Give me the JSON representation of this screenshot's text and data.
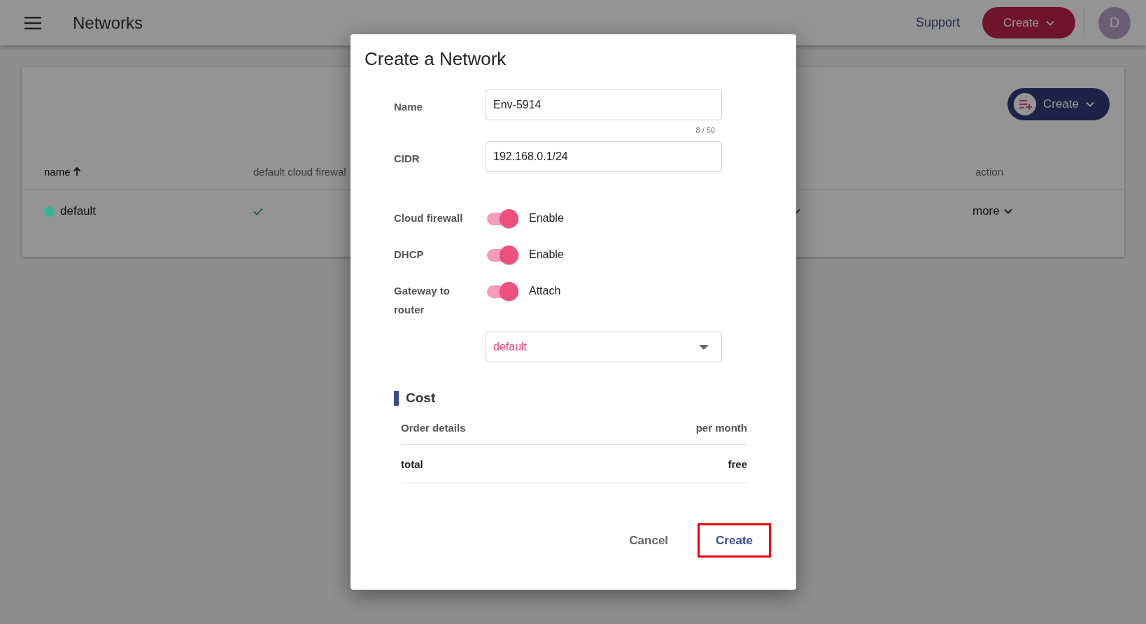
{
  "header": {
    "title": "Networks",
    "support_link": "Support",
    "create_button": "Create",
    "avatar": "D"
  },
  "card": {
    "create_button": "Create",
    "columns": [
      {
        "label": "name",
        "sorted": true
      },
      {
        "label": "default cloud firewal",
        "sorted": false
      },
      {
        "label": "action",
        "sorted": false
      }
    ],
    "rows": [
      {
        "name": "default",
        "color": "#36b596",
        "firewall": true,
        "action": "more"
      }
    ]
  },
  "dialog": {
    "title": "Create a Network",
    "fields": [
      {
        "label": "Name",
        "value": "Env-5914",
        "counter": "8 / 50"
      },
      {
        "label": "CIDR",
        "value": "192.168.0.1/24"
      }
    ],
    "toggles": [
      {
        "label": "Cloud firewall",
        "on": true,
        "text": "Enable"
      },
      {
        "label": "DHCP",
        "on": true,
        "text": "Enable"
      },
      {
        "label": "Gateway to router",
        "on": true,
        "text": "Attach"
      }
    ],
    "router_select": {
      "value": "default"
    },
    "cost": {
      "title": "Cost",
      "head": [
        "Order details",
        "per month"
      ],
      "rows": [
        {
          "label": "total",
          "value": "free"
        }
      ]
    },
    "buttons": [
      {
        "label": "Cancel",
        "kind": "text",
        "highlighted": false
      },
      {
        "label": "Create",
        "kind": "primary",
        "highlighted": true
      }
    ]
  }
}
